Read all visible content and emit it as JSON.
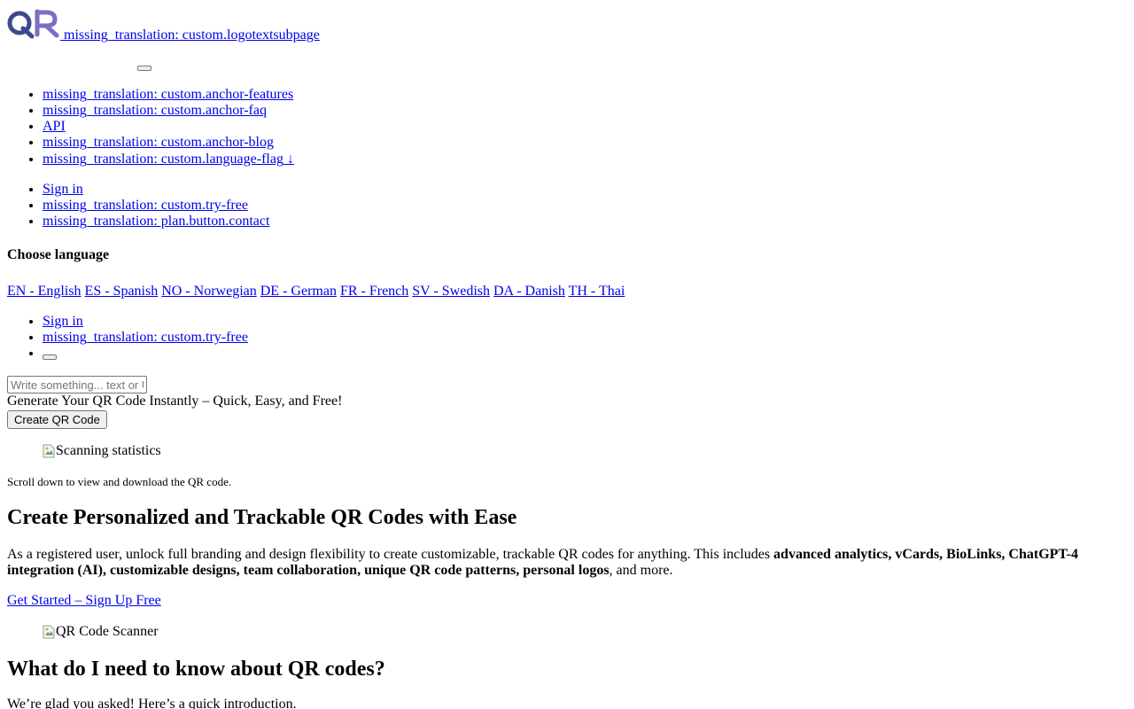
{
  "header": {
    "logo_text": "missing_translation: custom.logotextsubpage",
    "logo_alt_colors": [
      "#3c4a8c",
      "#7a6fc7"
    ]
  },
  "nav": {
    "items": [
      {
        "label": "missing_translation: custom.anchor-features"
      },
      {
        "label": "missing_translation: custom.anchor-faq"
      },
      {
        "label": "API"
      },
      {
        "label": "missing_translation: custom.anchor-blog"
      },
      {
        "label": "missing_translation: custom.language-flag",
        "icon": "↓"
      }
    ]
  },
  "auth": {
    "sign_in": "Sign in",
    "try_free": "missing_translation: custom.try-free",
    "contact": "missing_translation: plan.button.contact"
  },
  "language": {
    "heading": "Choose language",
    "options": [
      "EN - English",
      "ES - Spanish",
      "NO - Norwegian",
      "DE - German",
      "FR - French",
      "SV - Swedish",
      "DA - Danish",
      "TH - Thai"
    ]
  },
  "mobile_nav": {
    "sign_in": "Sign in",
    "try_free": "missing_translation: custom.try-free"
  },
  "generator": {
    "input_placeholder": "Write something... text or URL",
    "input_value": "",
    "headline": "Generate Your QR Code Instantly – Quick, Easy, and Free!",
    "button_label": "Create QR Code"
  },
  "images": {
    "scanning_alt": "Scanning statistics",
    "scanner_alt": "QR Code Scanner"
  },
  "scan_note": "Scroll down to view and download the QR code.",
  "section_personalized": {
    "title": "Create Personalized and Trackable QR Codes with Ease",
    "text_before": "As a registered user, unlock full branding and design flexibility to create customizable, trackable QR codes for anything. This includes ",
    "text_bold": "advanced analytics, vCards, BioLinks, ChatGPT-4 integration (AI), customizable designs, team collaboration, unique QR code patterns, personal logos",
    "text_after": ", and more.",
    "cta": "Get Started – Sign Up Free"
  },
  "section_faq": {
    "title": "What do I need to know about QR codes?",
    "intro": "We’re glad you asked! Here’s a quick introduction."
  },
  "colors": {
    "link": "#0000ee",
    "text": "#000000",
    "background": "#ffffff"
  }
}
